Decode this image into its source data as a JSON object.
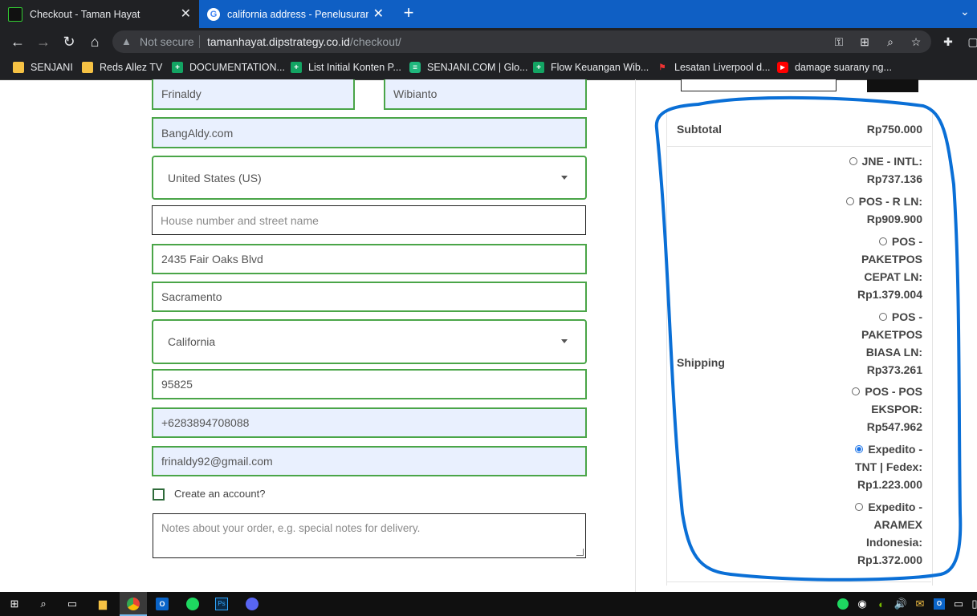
{
  "browser": {
    "tabs": [
      {
        "title": "Checkout - Taman Hayat",
        "active": true
      },
      {
        "title": "california address - Penelusuran G",
        "active": false
      }
    ],
    "new_tab": "+",
    "address": {
      "security_label": "Not secure",
      "domain": "tamanhayat.dipstrategy.co.id",
      "path": "/checkout/"
    },
    "bookmarks": [
      {
        "label": "SENJANI",
        "icon": "folder-icon"
      },
      {
        "label": "Reds Allez TV",
        "icon": "folder-icon"
      },
      {
        "label": "DOCUMENTATION...",
        "icon": "sheets-icon"
      },
      {
        "label": "List Initial Konten P...",
        "icon": "sheets-icon"
      },
      {
        "label": "SENJANI.COM | Glo...",
        "icon": "site-icon"
      },
      {
        "label": "Flow Keuangan Wib...",
        "icon": "sheets-icon"
      },
      {
        "label": "Lesatan Liverpool d...",
        "icon": "site-icon"
      },
      {
        "label": "damage suarany ng...",
        "icon": "youtube-icon"
      }
    ]
  },
  "form": {
    "first_name": "Frinaldy",
    "last_name": "Wibianto",
    "company": "BangAldy.com",
    "country": "United States (US)",
    "street_placeholder": "House number and street name",
    "apartment": "2435 Fair Oaks Blvd",
    "city": "Sacramento",
    "state": "California",
    "zip": "95825",
    "phone": "+6283894708088",
    "email": "frinaldy92@gmail.com",
    "create_account_label": "Create an account?",
    "notes_placeholder": "Notes about your order, e.g. special notes for delivery."
  },
  "summary": {
    "subtotal_label": "Subtotal",
    "subtotal_value": "Rp750.000",
    "shipping_label": "Shipping",
    "shipping_options": [
      {
        "lines": [
          "JNE - INTL:",
          "Rp737.136"
        ],
        "selected": false
      },
      {
        "lines": [
          "POS - R LN:",
          "Rp909.900"
        ],
        "selected": false
      },
      {
        "lines": [
          "POS -",
          "PAKETPOS",
          "CEPAT LN:",
          "Rp1.379.004"
        ],
        "selected": false
      },
      {
        "lines": [
          "POS -",
          "PAKETPOS",
          "BIASA LN:",
          "Rp373.261"
        ],
        "selected": false
      },
      {
        "lines": [
          "POS - POS",
          "EKSPOR:",
          "Rp547.962"
        ],
        "selected": false
      },
      {
        "lines": [
          "Expedito -",
          "TNT | Fedex:",
          "Rp1.223.000"
        ],
        "selected": true
      },
      {
        "lines": [
          "Expedito -",
          "ARAMEX",
          "Indonesia:",
          "Rp1.372.000"
        ],
        "selected": false
      }
    ]
  },
  "colors": {
    "field_border": "#4aa548",
    "annotation": "#0a6fd6",
    "tabstrip": "#0f5fc4"
  }
}
